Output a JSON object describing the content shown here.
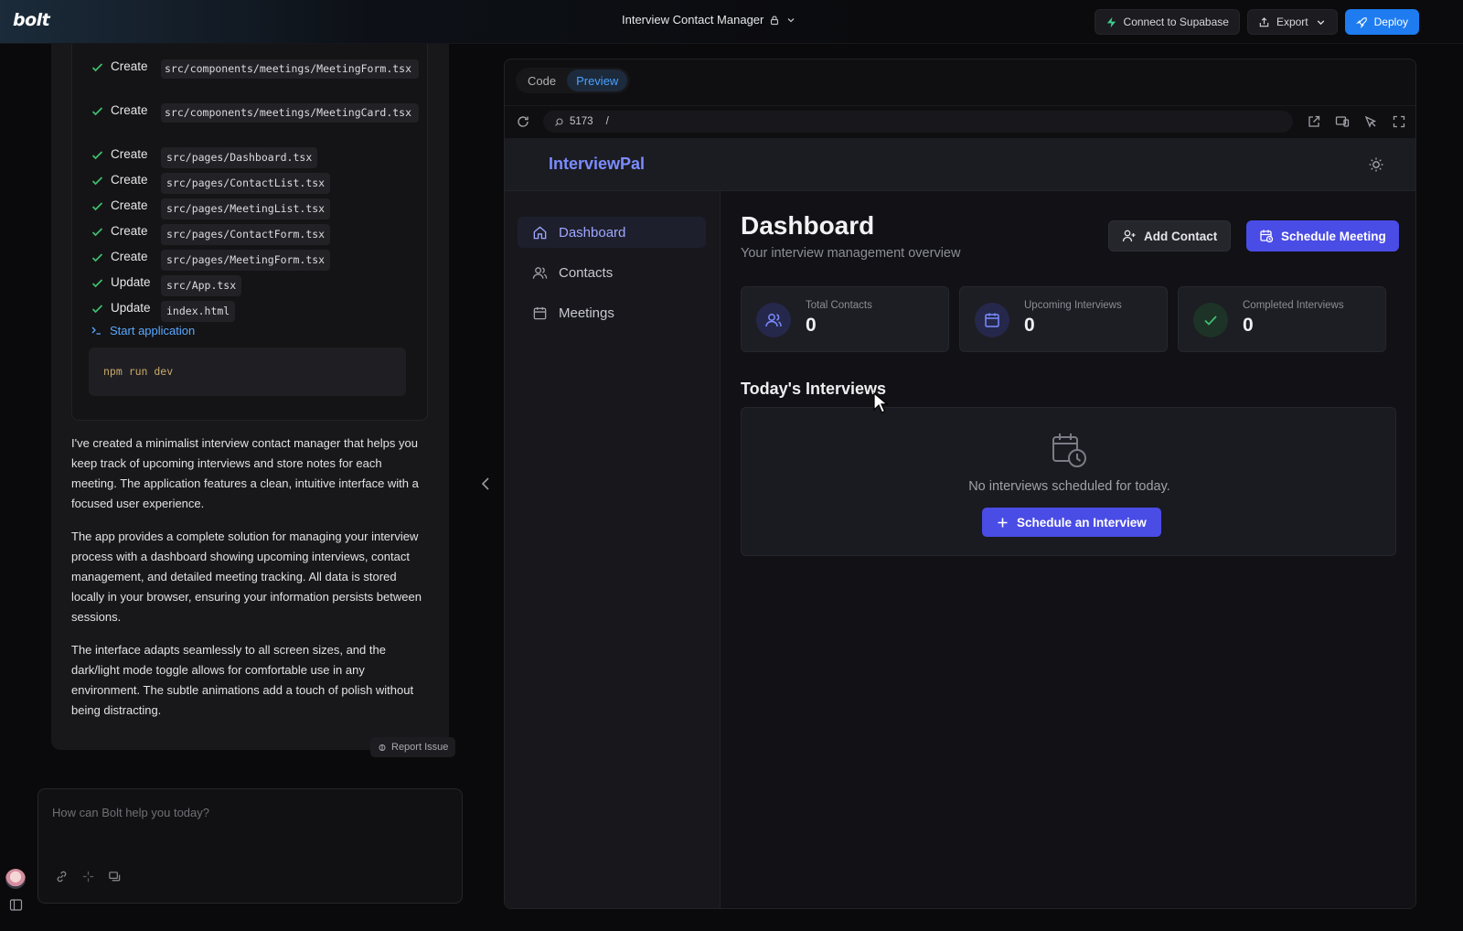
{
  "topbar": {
    "logo": "bolt",
    "project_title": "Interview Contact Manager",
    "buttons": {
      "supabase": "Connect to Supabase",
      "export": "Export",
      "deploy": "Deploy"
    }
  },
  "chat": {
    "actions": [
      {
        "verb": "Create",
        "path": "src/components/meetings/MeetingForm.tsx"
      },
      {
        "verb": "Create",
        "path": "src/components/meetings/MeetingCard.tsx"
      },
      {
        "verb": "Create",
        "path": "src/pages/Dashboard.tsx"
      },
      {
        "verb": "Create",
        "path": "src/pages/ContactList.tsx"
      },
      {
        "verb": "Create",
        "path": "src/pages/MeetingList.tsx"
      },
      {
        "verb": "Create",
        "path": "src/pages/ContactForm.tsx"
      },
      {
        "verb": "Create",
        "path": "src/pages/MeetingForm.tsx"
      },
      {
        "verb": "Update",
        "path": "src/App.tsx"
      },
      {
        "verb": "Update",
        "path": "index.html"
      }
    ],
    "start_label": "Start application",
    "command": "npm run dev",
    "paragraphs": [
      "I've created a minimalist interview contact manager that helps you keep track of upcoming interviews and store notes for each meeting. The application features a clean, intuitive interface with a focused user experience.",
      "The app provides a complete solution for managing your interview process with a dashboard showing upcoming interviews, contact management, and detailed meeting tracking. All data is stored locally in your browser, ensuring your information persists between sessions.",
      "The interface adapts seamlessly to all screen sizes, and the dark/light mode toggle allows for comfortable use in any environment. The subtle animations add a touch of polish without being distracting."
    ],
    "report_issue": "Report Issue",
    "prompt_placeholder": "How can Bolt help you today?"
  },
  "workbench": {
    "tabs": [
      "Code",
      "Preview"
    ],
    "active_tab": "Preview",
    "port": "5173",
    "path": "/"
  },
  "app": {
    "brand": "InterviewPal",
    "nav": [
      "Dashboard",
      "Contacts",
      "Meetings"
    ],
    "active_nav": "Dashboard",
    "title": "Dashboard",
    "subtitle": "Your interview management overview",
    "add_contact": "Add Contact",
    "schedule_meeting": "Schedule Meeting",
    "stats": [
      {
        "label": "Total Contacts",
        "value": "0",
        "icon": "users-icon",
        "color": "#7b8cff"
      },
      {
        "label": "Upcoming Interviews",
        "value": "0",
        "icon": "calendar-icon",
        "color": "#7b8cff"
      },
      {
        "label": "Completed Interviews",
        "value": "0",
        "icon": "check-icon",
        "color": "#3fbf6f"
      }
    ],
    "section_title": "Today's Interviews",
    "empty_text": "No interviews scheduled for today.",
    "empty_button": "Schedule an Interview"
  },
  "colors": {
    "accent": "#4a4ce6",
    "brand": "#7b8cff",
    "deploy": "#1e7cf0",
    "success": "#3fbf6f",
    "link": "#5aa8ff"
  }
}
